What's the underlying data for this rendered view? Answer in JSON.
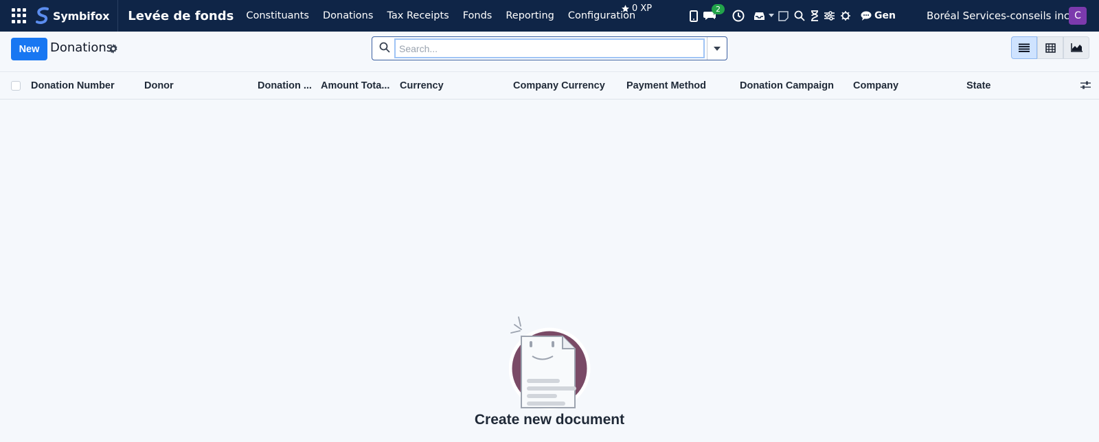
{
  "navbar": {
    "brand": "Symbifox",
    "app_title": "Levée de fonds",
    "menu": [
      "Constituants",
      "Donations",
      "Tax Receipts",
      "Fonds",
      "Reporting",
      "Configuration"
    ],
    "xp": "0 XP",
    "chat_count": "2",
    "gen_label": "Gen",
    "company": "Boréal Services-conseils inc.",
    "avatar_letter": "C"
  },
  "control": {
    "new_label": "New",
    "breadcrumb": "Donations",
    "search_placeholder": "Search..."
  },
  "table": {
    "columns": [
      "Donation Number",
      "Donor",
      "Donation ...",
      "Amount Tota...",
      "Currency",
      "Company Currency",
      "Payment Method",
      "Donation Campaign",
      "Company",
      "State"
    ]
  },
  "empty_state": {
    "title": "Create new document"
  },
  "colors": {
    "navbar_bg": "#0f2547",
    "primary": "#1877f2",
    "badge": "#22a34a",
    "avatar": "#7c3aad",
    "illustration_circle": "#7a4a66"
  }
}
